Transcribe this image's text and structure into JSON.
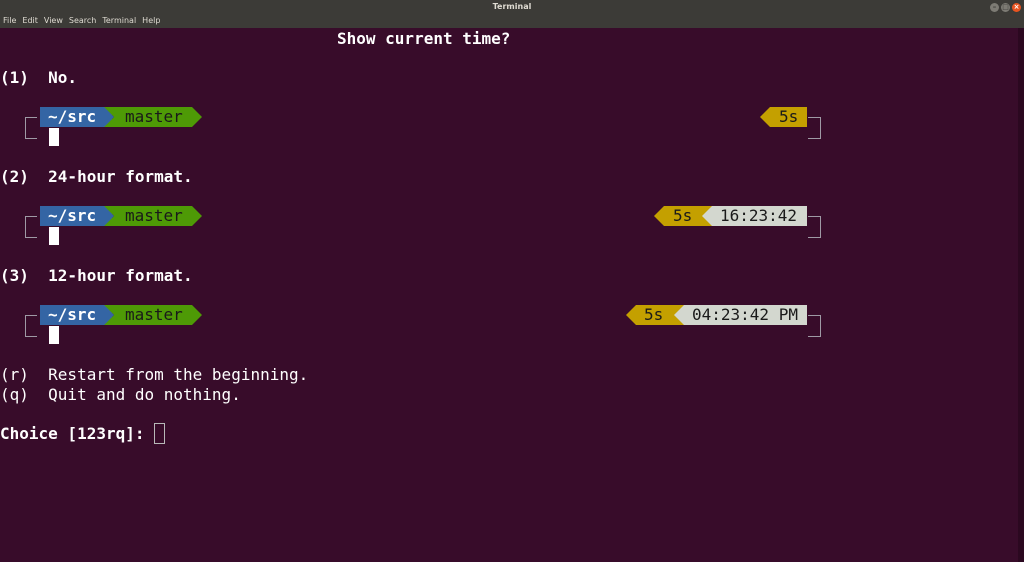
{
  "window": {
    "title": "Terminal"
  },
  "menu": [
    "File",
    "Edit",
    "View",
    "Search",
    "Terminal",
    "Help"
  ],
  "colors": {
    "bg": "#380c2a",
    "dir": "#3465a4",
    "git": "#4e9a06",
    "duration": "#c4a000",
    "time": "#d3d7cf"
  },
  "heading": "Show current time?",
  "options": [
    {
      "label": "(1)  No.",
      "dir": "~/src",
      "branch": "master",
      "duration": "5s",
      "time": ""
    },
    {
      "label": "(2)  24-hour format.",
      "dir": "~/src",
      "branch": "master",
      "duration": "5s",
      "time": "16:23:42"
    },
    {
      "label": "(3)  12-hour format.",
      "dir": "~/src",
      "branch": "master",
      "duration": "5s",
      "time": "04:23:42 PM"
    }
  ],
  "restart": "(r)  Restart from the beginning.",
  "quit": "(q)  Quit and do nothing.",
  "prompt": "Choice [123rq]: "
}
